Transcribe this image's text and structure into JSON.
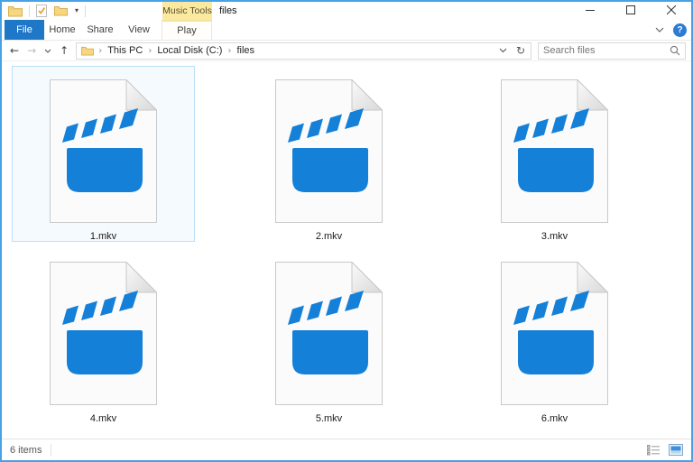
{
  "window": {
    "title": "files",
    "contextual_group_label": "Music Tools",
    "caption_buttons": [
      "minimize",
      "maximize",
      "close"
    ]
  },
  "quick_access_toolbar": {
    "icons": [
      "explorer-folder",
      "properties-check",
      "new-folder"
    ],
    "dropdown_glyph": "▾"
  },
  "ribbon": {
    "tabs": [
      {
        "label": "File",
        "active": true
      },
      {
        "label": "Home"
      },
      {
        "label": "Share"
      },
      {
        "label": "View"
      },
      {
        "label": "Play",
        "contextual": true
      }
    ],
    "expand_chevron": "⌄",
    "help_glyph": "?"
  },
  "navigation": {
    "back_glyph": "←",
    "forward_glyph": "→",
    "history_dropdown_glyph": "⌄",
    "up_glyph": "↑"
  },
  "address_bar": {
    "breadcrumb": [
      "This PC",
      "Local Disk (C:)",
      "files"
    ],
    "separator": "›",
    "dropdown_glyph": "⌄",
    "refresh_glyph": "↻"
  },
  "search": {
    "placeholder": "Search files"
  },
  "files": [
    {
      "name": "1.mkv",
      "selected": true
    },
    {
      "name": "2.mkv",
      "selected": false
    },
    {
      "name": "3.mkv",
      "selected": false
    },
    {
      "name": "4.mkv",
      "selected": false
    },
    {
      "name": "5.mkv",
      "selected": false
    },
    {
      "name": "6.mkv",
      "selected": false
    }
  ],
  "status_bar": {
    "items_count": "6 items",
    "view_buttons": [
      "details-view",
      "large-thumbnails-view"
    ]
  },
  "colors": {
    "accent": "#47A1E5",
    "file_tab": "#1F77C8",
    "icon_blue": "#1580D8",
    "contextual_bg": "#FCE9A0",
    "sel_border": "#BFE0F7",
    "sel_fill": "#F5FAFE"
  }
}
